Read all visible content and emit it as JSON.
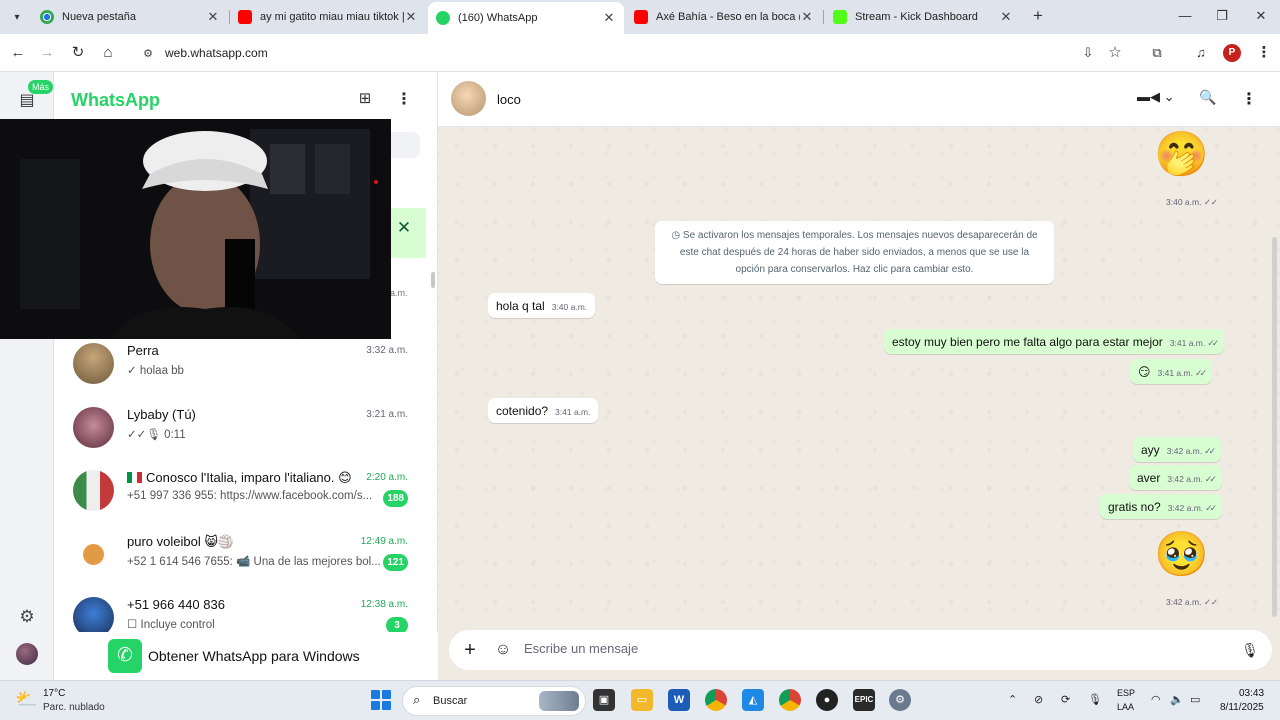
{
  "browser": {
    "tabs": [
      {
        "title": "Nueva pestaña",
        "favicon": "chrome-icon",
        "active": false
      },
      {
        "title": "ay mi gatito miau miau tiktok | ",
        "favicon": "youtube-icon",
        "active": false
      },
      {
        "title": "(160) WhatsApp",
        "favicon": "whatsapp-icon",
        "active": true
      },
      {
        "title": "Axé Bahía - Beso en la boca (Po",
        "favicon": "youtube-icon",
        "active": false
      },
      {
        "title": "Stream - Kick Dashboard",
        "favicon": "kick-icon",
        "active": false
      }
    ],
    "url": "web.whatsapp.com",
    "profile_initial": "P"
  },
  "rail": {
    "badge": "Más"
  },
  "sidebar": {
    "title": "WhatsApp",
    "chats": [
      {
        "name": "Perra",
        "time": "3:32 a.m.",
        "preview": "✓ holaa bb",
        "unread": "",
        "avatar_color": "#6d5a3a"
      },
      {
        "name": "Lybaby (Tú)",
        "time": "3:21 a.m.",
        "preview": "✓✓🎙 0:11",
        "unread": "",
        "avatar_color": "#8a3f4f"
      },
      {
        "name": "Conosco l'Italia, imparo l'italiano. 😊",
        "time": "2:20 a.m.",
        "preview": "+51 997 336 955: https://www.facebook.com/s...",
        "unread": "188",
        "avatar_color": "#7e8f6a"
      },
      {
        "name": "puro voleibol 😸🏐",
        "time": "12:49 a.m.",
        "preview": "+52 1 614 546 7655: 📹 Una de las mejores bol...",
        "unread": "121",
        "avatar_color": "#d6893a"
      },
      {
        "name": "+51 966 440 836",
        "time": "12:38 a.m.",
        "preview": "☐ Incluye control",
        "unread": "3",
        "avatar_color": "#2d5b9a"
      }
    ],
    "get_app": "Obtener WhatsApp para Windows"
  },
  "conversation": {
    "contact": "loco",
    "system_message": "Se activaron los mensajes temporales. Los mensajes nuevos desaparecerán de este chat después de 24 horas de haber sido enviados, a menos que se use la opción para conservarlos. Haz clic para cambiar esto.",
    "messages": [
      {
        "dir": "out",
        "kind": "emoji",
        "text": "🤭",
        "time": "3:40 a.m."
      },
      {
        "dir": "in",
        "kind": "text",
        "text": "hola q tal",
        "time": "3:40 a.m."
      },
      {
        "dir": "out",
        "kind": "text",
        "text": "estoy muy bien pero me falta algo para estar mejor",
        "time": "3:41 a.m."
      },
      {
        "dir": "out",
        "kind": "text",
        "text": "😏",
        "time": "3:41 a.m."
      },
      {
        "dir": "in",
        "kind": "text",
        "text": "cotenido?",
        "time": "3:41 a.m."
      },
      {
        "dir": "out",
        "kind": "text",
        "text": "ayy",
        "time": "3:42 a.m."
      },
      {
        "dir": "out",
        "kind": "text",
        "text": "aver",
        "time": "3:42 a.m."
      },
      {
        "dir": "out",
        "kind": "text",
        "text": "gratis no?",
        "time": "3:42 a.m."
      },
      {
        "dir": "out",
        "kind": "emoji",
        "text": "🥹",
        "time": "3:42 a.m."
      }
    ],
    "composer_placeholder": "Escribe un mensaje"
  },
  "taskbar": {
    "temp": "17°C",
    "weather": "Parc. nublado",
    "search": "Buscar",
    "lang1": "ESP",
    "lang2": "LAA",
    "time": "03:43",
    "date": "8/11/2025"
  },
  "colors": {
    "accent": "#25d366",
    "outgoing_bubble": "#d9fdd3",
    "chat_bg": "#efeae2"
  }
}
